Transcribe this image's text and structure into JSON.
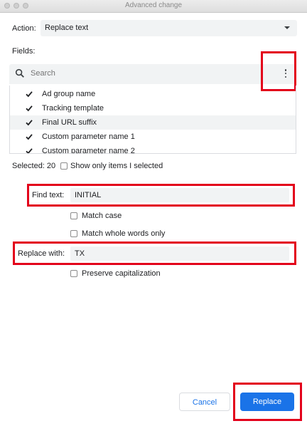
{
  "window": {
    "title": "Advanced change"
  },
  "action": {
    "label": "Action:",
    "value": "Replace text"
  },
  "fields": {
    "label": "Fields:",
    "search_placeholder": "Search",
    "items": [
      {
        "label": "Ad group name",
        "checked": true
      },
      {
        "label": "Tracking template",
        "checked": true
      },
      {
        "label": "Final URL suffix",
        "checked": true
      },
      {
        "label": "Custom parameter name 1",
        "checked": true
      },
      {
        "label": "Custom parameter name 2",
        "checked": true
      }
    ],
    "selected_text": "Selected: 20",
    "show_only_selected_label": "Show only items I selected"
  },
  "find": {
    "label": "Find text:",
    "value": "INITIAL"
  },
  "options": {
    "match_case": "Match case",
    "match_whole_words": "Match whole words only",
    "preserve_capitalization": "Preserve capitalization"
  },
  "replace": {
    "label": "Replace with:",
    "value": "TX"
  },
  "buttons": {
    "cancel": "Cancel",
    "replace": "Replace"
  },
  "colors": {
    "accent": "#1a73e8",
    "highlight_border": "#e3001b",
    "field_bg": "#f1f3f4"
  }
}
